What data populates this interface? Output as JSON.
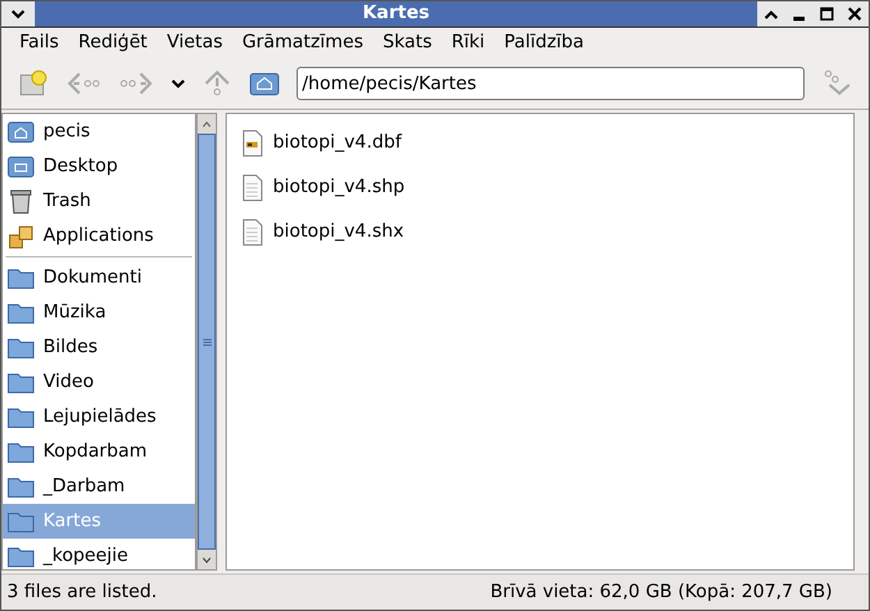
{
  "window": {
    "title": "Kartes"
  },
  "menu": [
    "Fails",
    "Rediģēt",
    "Vietas",
    "Grāmatzīmes",
    "Skats",
    "Rīki",
    "Palīdzība"
  ],
  "location": {
    "value": "/home/pecis/Kartes"
  },
  "sidebar": {
    "items": [
      {
        "label": "pecis",
        "kind": "home",
        "selected": false
      },
      {
        "label": "Desktop",
        "kind": "desktop",
        "selected": false
      },
      {
        "label": "Trash",
        "kind": "trash",
        "selected": false
      },
      {
        "label": "Applications",
        "kind": "apps",
        "selected": false
      },
      {
        "label": "Dokumenti",
        "kind": "folder",
        "selected": false
      },
      {
        "label": "Mūzika",
        "kind": "folder",
        "selected": false
      },
      {
        "label": "Bildes",
        "kind": "folder",
        "selected": false
      },
      {
        "label": "Video",
        "kind": "folder",
        "selected": false
      },
      {
        "label": "Lejupielādes",
        "kind": "folder",
        "selected": false
      },
      {
        "label": "Kopdarbam",
        "kind": "folder",
        "selected": false
      },
      {
        "label": "_Darbam",
        "kind": "folder",
        "selected": false
      },
      {
        "label": "Kartes",
        "kind": "folder",
        "selected": true
      },
      {
        "label": "_kopeejie",
        "kind": "folder",
        "selected": false
      }
    ]
  },
  "files": [
    {
      "name": "biotopi_v4.dbf",
      "kind": "data"
    },
    {
      "name": "biotopi_v4.shp",
      "kind": "text"
    },
    {
      "name": "biotopi_v4.shx",
      "kind": "text"
    }
  ],
  "status_bar": {
    "left": "3 files are listed.",
    "right": "Brīvā vieta: 62,0 GB (Kopā: 207,7 GB)"
  }
}
